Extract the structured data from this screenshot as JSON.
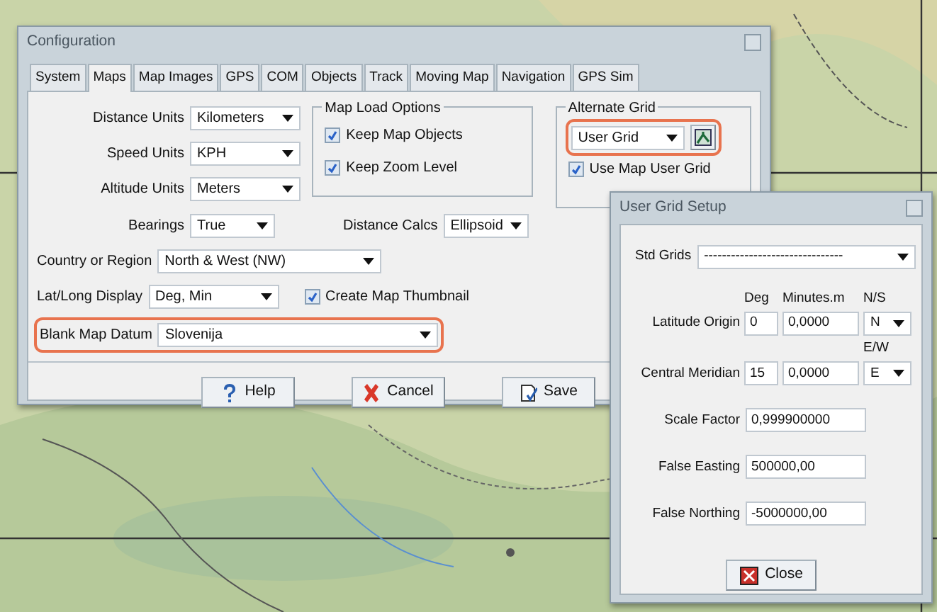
{
  "config_window": {
    "title": "Configuration",
    "tabs": [
      {
        "label": "System",
        "selected": false
      },
      {
        "label": "Maps",
        "selected": true
      },
      {
        "label": "Map Images",
        "selected": false
      },
      {
        "label": "GPS",
        "selected": false
      },
      {
        "label": "COM",
        "selected": false
      },
      {
        "label": "Objects",
        "selected": false
      },
      {
        "label": "Track",
        "selected": false
      },
      {
        "label": "Moving Map",
        "selected": false
      },
      {
        "label": "Navigation",
        "selected": false
      },
      {
        "label": "GPS Sim",
        "selected": false
      }
    ],
    "units": [
      {
        "label": "Distance Units",
        "value": "Kilometers"
      },
      {
        "label": "Speed Units",
        "value": "KPH"
      },
      {
        "label": "Altitude Units",
        "value": "Meters"
      }
    ],
    "map_load_options": {
      "title": "Map Load Options",
      "options": [
        {
          "label": "Keep Map Objects",
          "checked": true
        },
        {
          "label": "Keep Zoom Level",
          "checked": true
        }
      ]
    },
    "alternate_grid": {
      "title": "Alternate Grid",
      "value": "User Grid",
      "highlighted": true,
      "use_map_user_grid": {
        "label": "Use Map User Grid",
        "checked": true
      }
    },
    "bearings": {
      "label": "Bearings",
      "value": "True"
    },
    "distance_calcs": {
      "label": "Distance Calcs",
      "value": "Ellipsoid"
    },
    "country": {
      "label": "Country or Region",
      "value": "North & West (NW)"
    },
    "latlong": {
      "label": "Lat/Long Display",
      "value": "Deg, Min"
    },
    "thumbnail": {
      "label": "Create Map Thumbnail",
      "checked": true
    },
    "datum": {
      "label": "Blank Map Datum",
      "value": "Slovenija",
      "highlighted": true
    },
    "buttons": [
      {
        "kind": "help",
        "label": "Help"
      },
      {
        "kind": "cancel",
        "label": "Cancel"
      },
      {
        "kind": "save",
        "label": "Save"
      }
    ]
  },
  "user_grid_window": {
    "title": "User Grid Setup",
    "std_grids": {
      "label": "Std Grids",
      "value": "-------------------------------"
    },
    "headers": [
      "Deg",
      "Minutes.m",
      "N/S"
    ],
    "latitude_origin": {
      "label": "Latitude Origin",
      "deg": "0",
      "minutes": "0,0000",
      "dir": "N"
    },
    "ew_header": "E/W",
    "central_meridian": {
      "label": "Central Meridian",
      "deg": "15",
      "minutes": "0,0000",
      "dir": "E"
    },
    "fields": [
      {
        "label": "Scale Factor",
        "value": "0,999900000"
      },
      {
        "label": "False Easting",
        "value": "500000,00"
      },
      {
        "label": "False Northing",
        "value": "-5000000,00"
      }
    ],
    "close_button": "Close"
  }
}
